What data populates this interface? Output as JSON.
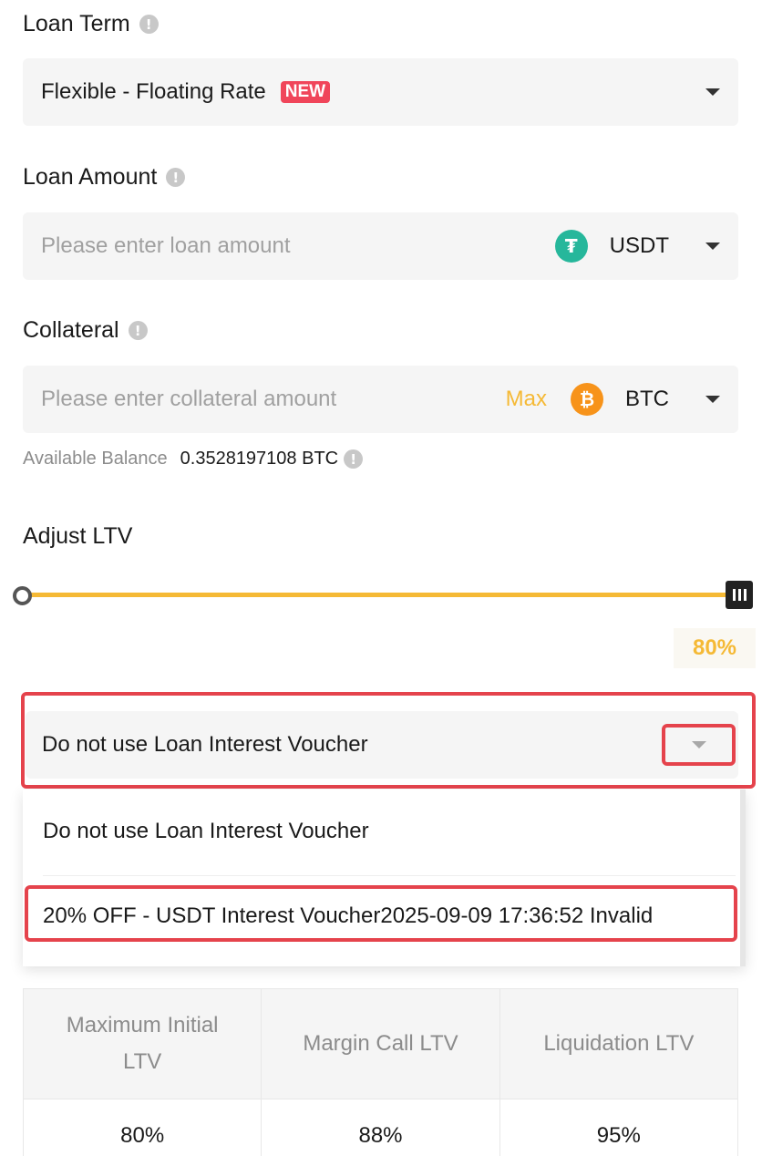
{
  "loan_term": {
    "label": "Loan Term",
    "value": "Flexible - Floating Rate",
    "badge": "NEW"
  },
  "loan_amount": {
    "label": "Loan Amount",
    "placeholder": "Please enter loan amount",
    "coin": "USDT",
    "coin_icon": "tether-icon"
  },
  "collateral": {
    "label": "Collateral",
    "placeholder": "Please enter collateral amount",
    "max_label": "Max",
    "coin": "BTC",
    "coin_icon": "bitcoin-icon"
  },
  "balance": {
    "label": "Available Balance",
    "value": "0.3528197108 BTC"
  },
  "ltv": {
    "label": "Adjust LTV",
    "value_text": "80%",
    "slider_fraction": 1.0
  },
  "voucher": {
    "selected": "Do not use Loan Interest Voucher",
    "options": [
      "Do not use Loan Interest Voucher",
      "20% OFF - USDT Interest Voucher2025-09-09 17:36:52 Invalid"
    ]
  },
  "ltv_table": {
    "headers": [
      "Maximum Initial LTV",
      "Margin Call LTV",
      "Liquidation LTV"
    ],
    "values": [
      "80%",
      "88%",
      "95%"
    ]
  },
  "colors": {
    "accent": "#f5b935",
    "highlight": "#e5434c",
    "badge": "#f0455a",
    "usdt": "#26b79b",
    "btc": "#f7931a"
  }
}
